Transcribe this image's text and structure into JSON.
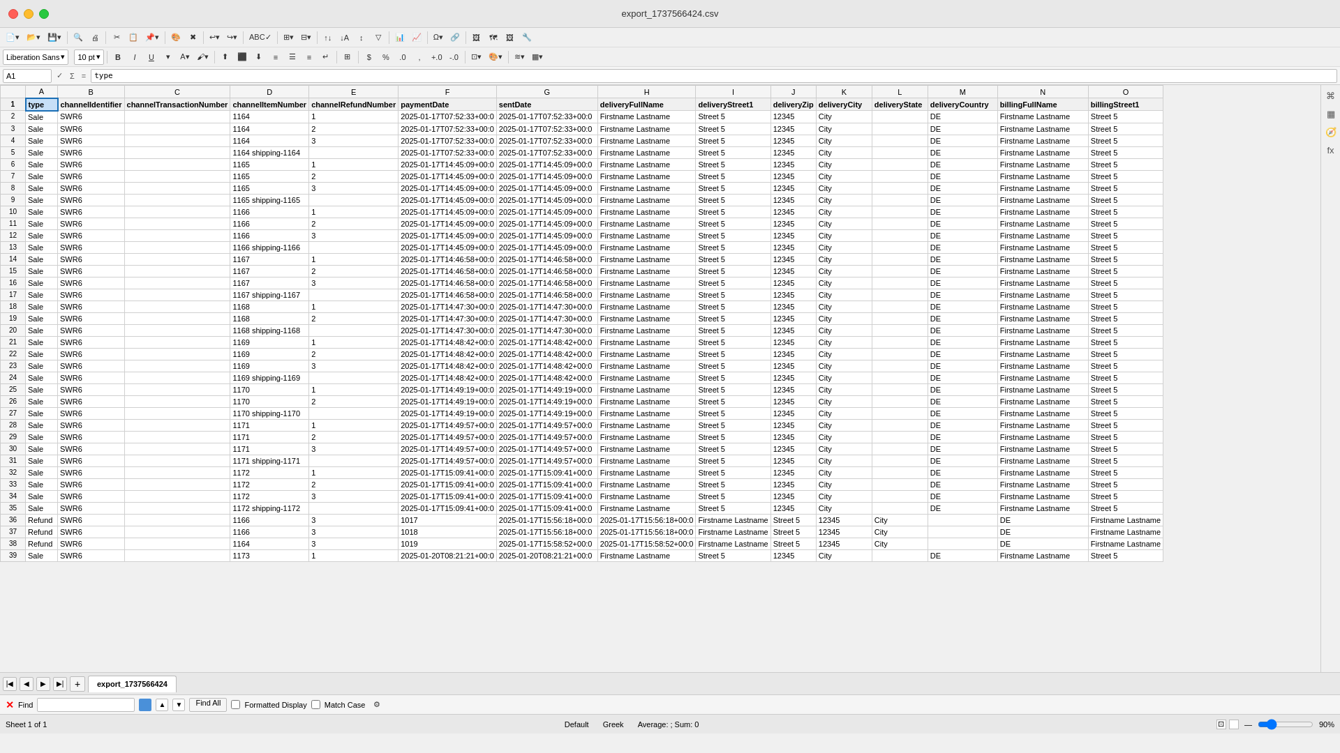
{
  "titleBar": {
    "title": "export_1737566424.csv"
  },
  "formulaBar": {
    "cellRef": "A1",
    "formula": "type"
  },
  "columns": [
    "A",
    "B",
    "C",
    "D",
    "E",
    "F",
    "G",
    "H",
    "I",
    "J",
    "K",
    "L",
    "M",
    "N",
    "O"
  ],
  "columnHeaders": [
    "type",
    "channelIdentifier",
    "channelTransactionNumber",
    "channelItemNumber",
    "channelRefundNumber",
    "paymentDate",
    "sentDate",
    "deliveryFullName",
    "deliveryStreet1",
    "deliveryZip",
    "deliveryCity",
    "deliveryState",
    "deliveryCountry",
    "billingFullName",
    "billingStreet1"
  ],
  "rows": [
    [
      "Sale",
      "SWR6",
      "",
      "1164",
      "1",
      "2025-01-17T07:52:33+00:0",
      "2025-01-17T07:52:33+00:0",
      "Firstname Lastname",
      "Street 5",
      "12345",
      "City",
      "",
      "DE",
      "Firstname Lastname",
      "Street 5"
    ],
    [
      "Sale",
      "SWR6",
      "",
      "1164",
      "2",
      "2025-01-17T07:52:33+00:0",
      "2025-01-17T07:52:33+00:0",
      "Firstname Lastname",
      "Street 5",
      "12345",
      "City",
      "",
      "DE",
      "Firstname Lastname",
      "Street 5"
    ],
    [
      "Sale",
      "SWR6",
      "",
      "1164",
      "3",
      "2025-01-17T07:52:33+00:0",
      "2025-01-17T07:52:33+00:0",
      "Firstname Lastname",
      "Street 5",
      "12345",
      "City",
      "",
      "DE",
      "Firstname Lastname",
      "Street 5"
    ],
    [
      "Sale",
      "SWR6",
      "",
      "1164 shipping-1164",
      "",
      "2025-01-17T07:52:33+00:0",
      "2025-01-17T07:52:33+00:0",
      "Firstname Lastname",
      "Street 5",
      "12345",
      "City",
      "",
      "DE",
      "Firstname Lastname",
      "Street 5"
    ],
    [
      "Sale",
      "SWR6",
      "",
      "1165",
      "1",
      "2025-01-17T14:45:09+00:0",
      "2025-01-17T14:45:09+00:0",
      "Firstname Lastname",
      "Street 5",
      "12345",
      "City",
      "",
      "DE",
      "Firstname Lastname",
      "Street 5"
    ],
    [
      "Sale",
      "SWR6",
      "",
      "1165",
      "2",
      "2025-01-17T14:45:09+00:0",
      "2025-01-17T14:45:09+00:0",
      "Firstname Lastname",
      "Street 5",
      "12345",
      "City",
      "",
      "DE",
      "Firstname Lastname",
      "Street 5"
    ],
    [
      "Sale",
      "SWR6",
      "",
      "1165",
      "3",
      "2025-01-17T14:45:09+00:0",
      "2025-01-17T14:45:09+00:0",
      "Firstname Lastname",
      "Street 5",
      "12345",
      "City",
      "",
      "DE",
      "Firstname Lastname",
      "Street 5"
    ],
    [
      "Sale",
      "SWR6",
      "",
      "1165 shipping-1165",
      "",
      "2025-01-17T14:45:09+00:0",
      "2025-01-17T14:45:09+00:0",
      "Firstname Lastname",
      "Street 5",
      "12345",
      "City",
      "",
      "DE",
      "Firstname Lastname",
      "Street 5"
    ],
    [
      "Sale",
      "SWR6",
      "",
      "1166",
      "1",
      "2025-01-17T14:45:09+00:0",
      "2025-01-17T14:45:09+00:0",
      "Firstname Lastname",
      "Street 5",
      "12345",
      "City",
      "",
      "DE",
      "Firstname Lastname",
      "Street 5"
    ],
    [
      "Sale",
      "SWR6",
      "",
      "1166",
      "2",
      "2025-01-17T14:45:09+00:0",
      "2025-01-17T14:45:09+00:0",
      "Firstname Lastname",
      "Street 5",
      "12345",
      "City",
      "",
      "DE",
      "Firstname Lastname",
      "Street 5"
    ],
    [
      "Sale",
      "SWR6",
      "",
      "1166",
      "3",
      "2025-01-17T14:45:09+00:0",
      "2025-01-17T14:45:09+00:0",
      "Firstname Lastname",
      "Street 5",
      "12345",
      "City",
      "",
      "DE",
      "Firstname Lastname",
      "Street 5"
    ],
    [
      "Sale",
      "SWR6",
      "",
      "1166 shipping-1166",
      "",
      "2025-01-17T14:45:09+00:0",
      "2025-01-17T14:45:09+00:0",
      "Firstname Lastname",
      "Street 5",
      "12345",
      "City",
      "",
      "DE",
      "Firstname Lastname",
      "Street 5"
    ],
    [
      "Sale",
      "SWR6",
      "",
      "1167",
      "1",
      "2025-01-17T14:46:58+00:0",
      "2025-01-17T14:46:58+00:0",
      "Firstname Lastname",
      "Street 5",
      "12345",
      "City",
      "",
      "DE",
      "Firstname Lastname",
      "Street 5"
    ],
    [
      "Sale",
      "SWR6",
      "",
      "1167",
      "2",
      "2025-01-17T14:46:58+00:0",
      "2025-01-17T14:46:58+00:0",
      "Firstname Lastname",
      "Street 5",
      "12345",
      "City",
      "",
      "DE",
      "Firstname Lastname",
      "Street 5"
    ],
    [
      "Sale",
      "SWR6",
      "",
      "1167",
      "3",
      "2025-01-17T14:46:58+00:0",
      "2025-01-17T14:46:58+00:0",
      "Firstname Lastname",
      "Street 5",
      "12345",
      "City",
      "",
      "DE",
      "Firstname Lastname",
      "Street 5"
    ],
    [
      "Sale",
      "SWR6",
      "",
      "1167 shipping-1167",
      "",
      "2025-01-17T14:46:58+00:0",
      "2025-01-17T14:46:58+00:0",
      "Firstname Lastname",
      "Street 5",
      "12345",
      "City",
      "",
      "DE",
      "Firstname Lastname",
      "Street 5"
    ],
    [
      "Sale",
      "SWR6",
      "",
      "1168",
      "1",
      "2025-01-17T14:47:30+00:0",
      "2025-01-17T14:47:30+00:0",
      "Firstname Lastname",
      "Street 5",
      "12345",
      "City",
      "",
      "DE",
      "Firstname Lastname",
      "Street 5"
    ],
    [
      "Sale",
      "SWR6",
      "",
      "1168",
      "2",
      "2025-01-17T14:47:30+00:0",
      "2025-01-17T14:47:30+00:0",
      "Firstname Lastname",
      "Street 5",
      "12345",
      "City",
      "",
      "DE",
      "Firstname Lastname",
      "Street 5"
    ],
    [
      "Sale",
      "SWR6",
      "",
      "1168 shipping-1168",
      "",
      "2025-01-17T14:47:30+00:0",
      "2025-01-17T14:47:30+00:0",
      "Firstname Lastname",
      "Street 5",
      "12345",
      "City",
      "",
      "DE",
      "Firstname Lastname",
      "Street 5"
    ],
    [
      "Sale",
      "SWR6",
      "",
      "1169",
      "1",
      "2025-01-17T14:48:42+00:0",
      "2025-01-17T14:48:42+00:0",
      "Firstname Lastname",
      "Street 5",
      "12345",
      "City",
      "",
      "DE",
      "Firstname Lastname",
      "Street 5"
    ],
    [
      "Sale",
      "SWR6",
      "",
      "1169",
      "2",
      "2025-01-17T14:48:42+00:0",
      "2025-01-17T14:48:42+00:0",
      "Firstname Lastname",
      "Street 5",
      "12345",
      "City",
      "",
      "DE",
      "Firstname Lastname",
      "Street 5"
    ],
    [
      "Sale",
      "SWR6",
      "",
      "1169",
      "3",
      "2025-01-17T14:48:42+00:0",
      "2025-01-17T14:48:42+00:0",
      "Firstname Lastname",
      "Street 5",
      "12345",
      "City",
      "",
      "DE",
      "Firstname Lastname",
      "Street 5"
    ],
    [
      "Sale",
      "SWR6",
      "",
      "1169 shipping-1169",
      "",
      "2025-01-17T14:48:42+00:0",
      "2025-01-17T14:48:42+00:0",
      "Firstname Lastname",
      "Street 5",
      "12345",
      "City",
      "",
      "DE",
      "Firstname Lastname",
      "Street 5"
    ],
    [
      "Sale",
      "SWR6",
      "",
      "1170",
      "1",
      "2025-01-17T14:49:19+00:0",
      "2025-01-17T14:49:19+00:0",
      "Firstname Lastname",
      "Street 5",
      "12345",
      "City",
      "",
      "DE",
      "Firstname Lastname",
      "Street 5"
    ],
    [
      "Sale",
      "SWR6",
      "",
      "1170",
      "2",
      "2025-01-17T14:49:19+00:0",
      "2025-01-17T14:49:19+00:0",
      "Firstname Lastname",
      "Street 5",
      "12345",
      "City",
      "",
      "DE",
      "Firstname Lastname",
      "Street 5"
    ],
    [
      "Sale",
      "SWR6",
      "",
      "1170 shipping-1170",
      "",
      "2025-01-17T14:49:19+00:0",
      "2025-01-17T14:49:19+00:0",
      "Firstname Lastname",
      "Street 5",
      "12345",
      "City",
      "",
      "DE",
      "Firstname Lastname",
      "Street 5"
    ],
    [
      "Sale",
      "SWR6",
      "",
      "1171",
      "1",
      "2025-01-17T14:49:57+00:0",
      "2025-01-17T14:49:57+00:0",
      "Firstname Lastname",
      "Street 5",
      "12345",
      "City",
      "",
      "DE",
      "Firstname Lastname",
      "Street 5"
    ],
    [
      "Sale",
      "SWR6",
      "",
      "1171",
      "2",
      "2025-01-17T14:49:57+00:0",
      "2025-01-17T14:49:57+00:0",
      "Firstname Lastname",
      "Street 5",
      "12345",
      "City",
      "",
      "DE",
      "Firstname Lastname",
      "Street 5"
    ],
    [
      "Sale",
      "SWR6",
      "",
      "1171",
      "3",
      "2025-01-17T14:49:57+00:0",
      "2025-01-17T14:49:57+00:0",
      "Firstname Lastname",
      "Street 5",
      "12345",
      "City",
      "",
      "DE",
      "Firstname Lastname",
      "Street 5"
    ],
    [
      "Sale",
      "SWR6",
      "",
      "1171 shipping-1171",
      "",
      "2025-01-17T14:49:57+00:0",
      "2025-01-17T14:49:57+00:0",
      "Firstname Lastname",
      "Street 5",
      "12345",
      "City",
      "",
      "DE",
      "Firstname Lastname",
      "Street 5"
    ],
    [
      "Sale",
      "SWR6",
      "",
      "1172",
      "1",
      "2025-01-17T15:09:41+00:0",
      "2025-01-17T15:09:41+00:0",
      "Firstname Lastname",
      "Street 5",
      "12345",
      "City",
      "",
      "DE",
      "Firstname Lastname",
      "Street 5"
    ],
    [
      "Sale",
      "SWR6",
      "",
      "1172",
      "2",
      "2025-01-17T15:09:41+00:0",
      "2025-01-17T15:09:41+00:0",
      "Firstname Lastname",
      "Street 5",
      "12345",
      "City",
      "",
      "DE",
      "Firstname Lastname",
      "Street 5"
    ],
    [
      "Sale",
      "SWR6",
      "",
      "1172",
      "3",
      "2025-01-17T15:09:41+00:0",
      "2025-01-17T15:09:41+00:0",
      "Firstname Lastname",
      "Street 5",
      "12345",
      "City",
      "",
      "DE",
      "Firstname Lastname",
      "Street 5"
    ],
    [
      "Sale",
      "SWR6",
      "",
      "1172 shipping-1172",
      "",
      "2025-01-17T15:09:41+00:0",
      "2025-01-17T15:09:41+00:0",
      "Firstname Lastname",
      "Street 5",
      "12345",
      "City",
      "",
      "DE",
      "Firstname Lastname",
      "Street 5"
    ],
    [
      "Refund",
      "SWR6",
      "",
      "1166",
      "3",
      "1017",
      "2025-01-17T15:56:18+00:0",
      "2025-01-17T15:56:18+00:0",
      "Firstname Lastname",
      "Street 5",
      "12345",
      "City",
      "",
      "DE",
      "Firstname Lastname"
    ],
    [
      "Refund",
      "SWR6",
      "",
      "1166",
      "3",
      "1018",
      "2025-01-17T15:56:18+00:0",
      "2025-01-17T15:56:18+00:0",
      "Firstname Lastname",
      "Street 5",
      "12345",
      "City",
      "",
      "DE",
      "Firstname Lastname"
    ],
    [
      "Refund",
      "SWR6",
      "",
      "1164",
      "3",
      "1019",
      "2025-01-17T15:58:52+00:0",
      "2025-01-17T15:58:52+00:0",
      "Firstname Lastname",
      "Street 5",
      "12345",
      "City",
      "",
      "DE",
      "Firstname Lastname"
    ],
    [
      "Sale",
      "SWR6",
      "",
      "1173",
      "1",
      "2025-01-20T08:21:21+00:0",
      "2025-01-20T08:21:21+00:0",
      "Firstname Lastname",
      "Street 5",
      "12345",
      "City",
      "",
      "DE",
      "Firstname Lastname",
      "Street 5"
    ]
  ],
  "sheetTab": {
    "name": "export_1737566424"
  },
  "findBar": {
    "label": "Find",
    "placeholder": "",
    "findAllLabel": "Find All",
    "formattedDisplayLabel": "Formatted Display",
    "matchCaseLabel": "Match Case"
  },
  "statusBar": {
    "sheetInfo": "Sheet 1 of 1",
    "defaultText": "Default",
    "greekText": "Greek",
    "statsText": "Average: ; Sum: 0",
    "zoom": "90%"
  },
  "fontName": "Liberation Sans",
  "fontSize": "10 pt"
}
